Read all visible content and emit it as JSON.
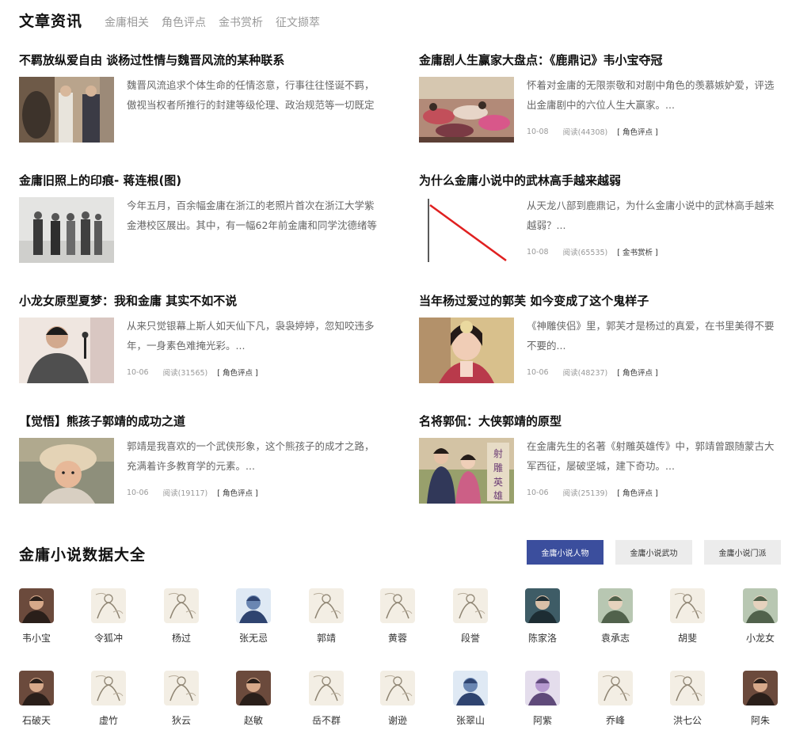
{
  "news": {
    "title": "文章资讯",
    "tabs": [
      "金庸相关",
      "角色评点",
      "金书赏析",
      "征文撷萃"
    ]
  },
  "articles": [
    {
      "title": "不羁放纵爱自由 谈杨过性情与魏晋风流的某种联系",
      "desc": "魏晋风流追求个体生命的任情恣意，行事往往怪诞不羁，傲视当权者所推行的封建等级伦理、政治规范等一切既定的社会意识...",
      "date": "",
      "reads": "",
      "tag": "",
      "thumb": "photo-warm"
    },
    {
      "title": "金庸剧人生赢家大盘点：《鹿鼎记》韦小宝夺冠",
      "desc": "怀着对金庸的无限崇敬和对剧中角色的羡慕嫉妒爱，评选出金庸剧中的六位人生大赢家。...",
      "date": "10-08",
      "reads": "阅读(44308)",
      "tag": "[ 角色评点 ]",
      "thumb": "photo-crowd"
    },
    {
      "title": "金庸旧照上的印痕- 蒋连根(图)",
      "desc": "今年五月，百余幅金庸在浙江的老照片首次在浙江大学紫金港校区展出。其中，有一幅62年前金庸和同学沈德绪等人在杭州...",
      "date": "",
      "reads": "",
      "tag": "",
      "thumb": "photo-bw"
    },
    {
      "title": "为什么金庸小说中的武林高手越来越弱",
      "desc": "从天龙八部到鹿鼎记，为什么金庸小说中的武林高手越来越弱？...",
      "date": "10-08",
      "reads": "阅读(65535)",
      "tag": "[ 金书赏析 ]",
      "thumb": "line-chart"
    },
    {
      "title": "小龙女原型夏梦：我和金庸 其实不如不说",
      "desc": "从来只觉银幕上斯人如天仙下凡，袅袅婷婷，忽知咬违多年，一身素色难掩光彩。...",
      "date": "10-06",
      "reads": "阅读(31565)",
      "tag": "[ 角色评点 ]",
      "thumb": "photo-portrait"
    },
    {
      "title": "当年杨过爱过的郭芙 如今变成了这个鬼样子",
      "desc": "《神雕侠侣》里，郭芙才是杨过的真爱，在书里美得不要不要的...",
      "date": "10-06",
      "reads": "阅读(48237)",
      "tag": "[ 角色评点 ]",
      "thumb": "photo-actress"
    },
    {
      "title": "【觉悟】熊孩子郭靖的成功之道",
      "desc": "郭靖是我喜欢的一个武侠形象，这个熊孩子的成才之路，充满着许多教育学的元素。...",
      "date": "10-06",
      "reads": "阅读(19117)",
      "tag": "[ 角色评点 ]",
      "thumb": "photo-hat"
    },
    {
      "title": "名将郭侃：大侠郭靖的原型",
      "desc": "在金庸先生的名著《射雕英雄传》中，郭靖曾跟随蒙古大军西征，屡破坚城，建下奇功。...",
      "date": "10-06",
      "reads": "阅读(25139)",
      "tag": "[ 角色评点 ]",
      "thumb": "photo-poster"
    }
  ],
  "data_section": {
    "title": "金庸小说数据大全",
    "tabs": [
      {
        "label": "金庸小说人物",
        "active": true
      },
      {
        "label": "金庸小说武功",
        "active": false
      },
      {
        "label": "金庸小说门派",
        "active": false
      }
    ],
    "accent_color": "#3b4e9d"
  },
  "characters": [
    {
      "name": "韦小宝",
      "style": "photo"
    },
    {
      "name": "令狐冲",
      "style": "ink"
    },
    {
      "name": "杨过",
      "style": "ink"
    },
    {
      "name": "张无忌",
      "style": "blue"
    },
    {
      "name": "郭靖",
      "style": "ink"
    },
    {
      "name": "黄蓉",
      "style": "ink"
    },
    {
      "name": "段誉",
      "style": "ink"
    },
    {
      "name": "陈家洛",
      "style": "teal"
    },
    {
      "name": "袁承志",
      "style": "green"
    },
    {
      "name": "胡斐",
      "style": "ink"
    },
    {
      "name": "小龙女",
      "style": "green"
    },
    {
      "name": "石破天",
      "style": "photo"
    },
    {
      "name": "虚竹",
      "style": "ink"
    },
    {
      "name": "狄云",
      "style": "ink"
    },
    {
      "name": "赵敏",
      "style": "photo"
    },
    {
      "name": "岳不群",
      "style": "ink"
    },
    {
      "name": "谢逊",
      "style": "ink"
    },
    {
      "name": "张翠山",
      "style": "blue"
    },
    {
      "name": "阿紫",
      "style": "purple"
    },
    {
      "name": "乔峰",
      "style": "ink"
    },
    {
      "name": "洪七公",
      "style": "ink"
    },
    {
      "name": "阿朱",
      "style": "photo"
    }
  ]
}
